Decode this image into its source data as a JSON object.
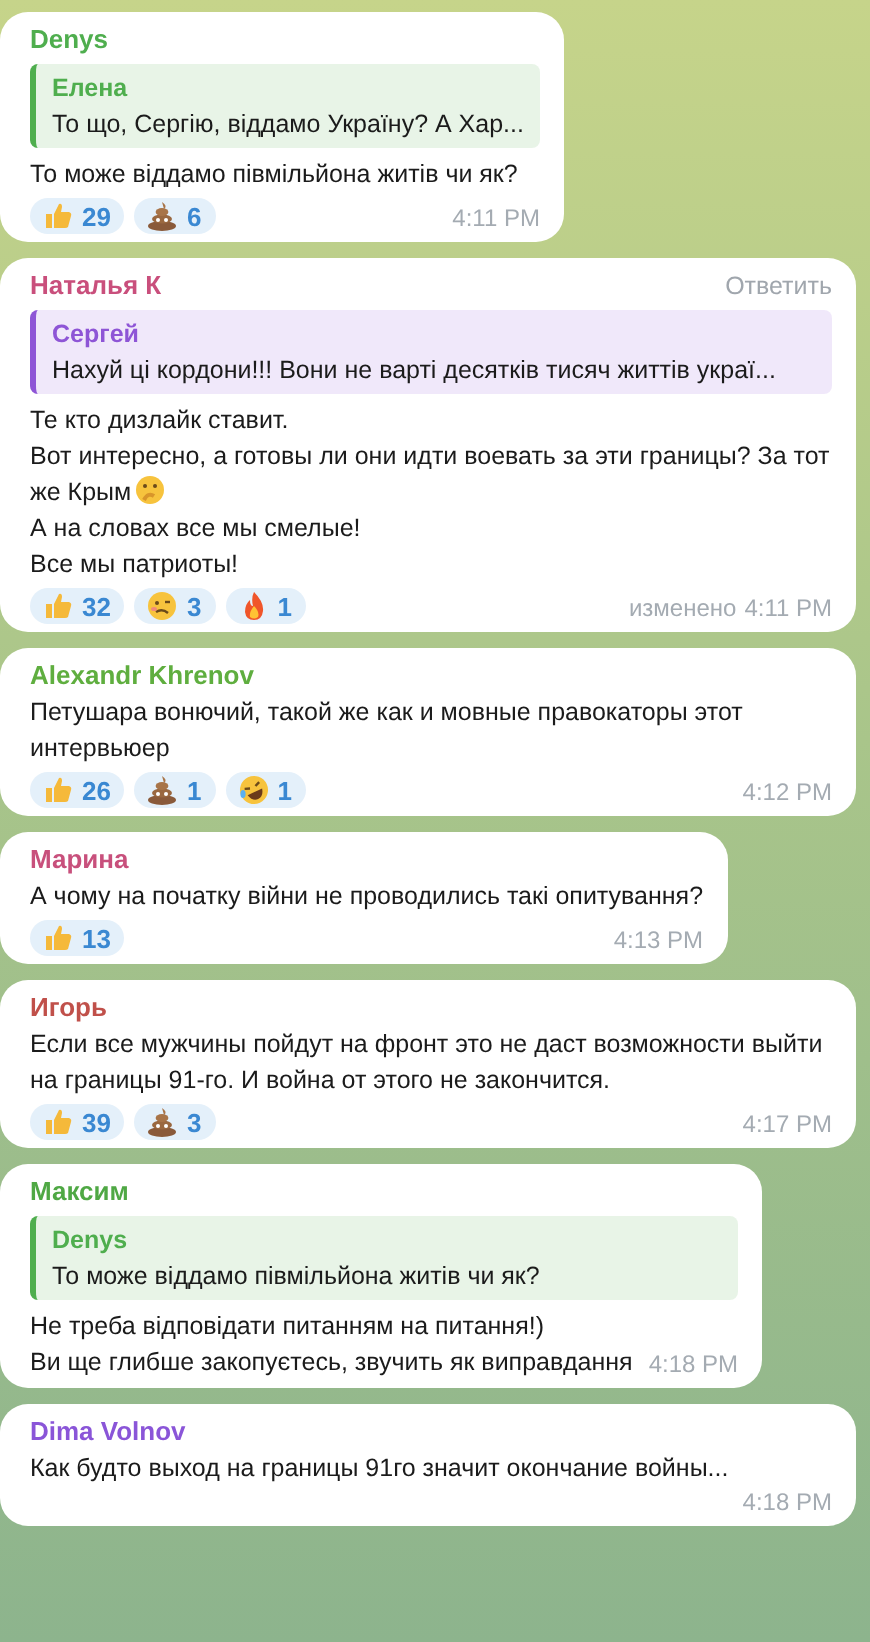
{
  "messages": [
    {
      "author": "Denys",
      "color": "#4fae4e",
      "reply": {
        "author": "Елена",
        "color": "#4fae4e",
        "text": "То що, Сергію, віддамо Україну? А Хар..."
      },
      "lines": [
        {
          "text": "То може віддамо півмільйона житів чи як?"
        }
      ],
      "reactions": [
        {
          "kind": "thumbs",
          "count": "29"
        },
        {
          "kind": "poop",
          "count": "6"
        }
      ],
      "time": "4:11 PM"
    },
    {
      "author": "Наталья К",
      "color": "#c94f7c",
      "action": "Ответить",
      "reply": {
        "author": "Сергей",
        "color": "#8e55d6",
        "text": "Нахуй ці кордони!!! Вони не варті десятків тисяч життів украї..."
      },
      "lines": [
        {
          "kind": "plain",
          "text": "Те кто дизлайк ставит."
        },
        {
          "kind": "emoji",
          "text": "Вот интересно, а готовы ли они идти воевать за эти границы? За тот же Крым"
        },
        {
          "kind": "plain",
          "text": "А на словах все мы смелые!"
        },
        {
          "kind": "plain",
          "text": "Все мы патриоты!"
        }
      ],
      "reactions": [
        {
          "kind": "thumbs",
          "count": "32"
        },
        {
          "kind": "woozy",
          "count": "3"
        },
        {
          "kind": "fire",
          "count": "1"
        }
      ],
      "edited": "изменено",
      "time": "4:11 PM"
    },
    {
      "author": "Alexandr Khrenov",
      "color": "#5fae3f",
      "lines": [
        {
          "text": "Петушара вонючий, такой же как и мовные правокаторы этот интервьюер"
        }
      ],
      "reactions": [
        {
          "kind": "thumbs",
          "count": "26"
        },
        {
          "kind": "poop",
          "count": "1"
        },
        {
          "kind": "laugh",
          "count": "1"
        }
      ],
      "time": "4:12 PM"
    },
    {
      "author": "Марина",
      "color": "#c8507c",
      "lines": [
        {
          "text": "А чому на початку війни не проводились такі опитування?"
        }
      ],
      "reactions": [
        {
          "kind": "thumbs",
          "count": "13"
        }
      ],
      "time": "4:13 PM"
    },
    {
      "author": "Игорь",
      "color": "#c0504a",
      "lines": [
        {
          "text": "Если все мужчины пойдут на фронт это не даст возможности выйти на границы 91-го. И война от этого не закончится."
        }
      ],
      "reactions": [
        {
          "kind": "thumbs",
          "count": "39"
        },
        {
          "kind": "poop",
          "count": "3"
        }
      ],
      "time": "4:17 PM"
    },
    {
      "author": "Максим",
      "color": "#4fa844",
      "reply": {
        "author": "Denys",
        "color": "#4fae4e",
        "text": "То може віддамо півмільйона житів чи як?"
      },
      "lines": [
        {
          "text": "Не треба відповідати питанням на питання!)"
        },
        {
          "text": "Ви ще глибше закопуєтесь, звучить як виправдання"
        }
      ],
      "time": "4:18 PM"
    },
    {
      "author": "Dima Volnov",
      "color": "#8a55d8",
      "lines": [
        {
          "text": "Как будто выход на границы 91го  значит окончание войны..."
        }
      ],
      "time": "4:18 PM"
    }
  ]
}
